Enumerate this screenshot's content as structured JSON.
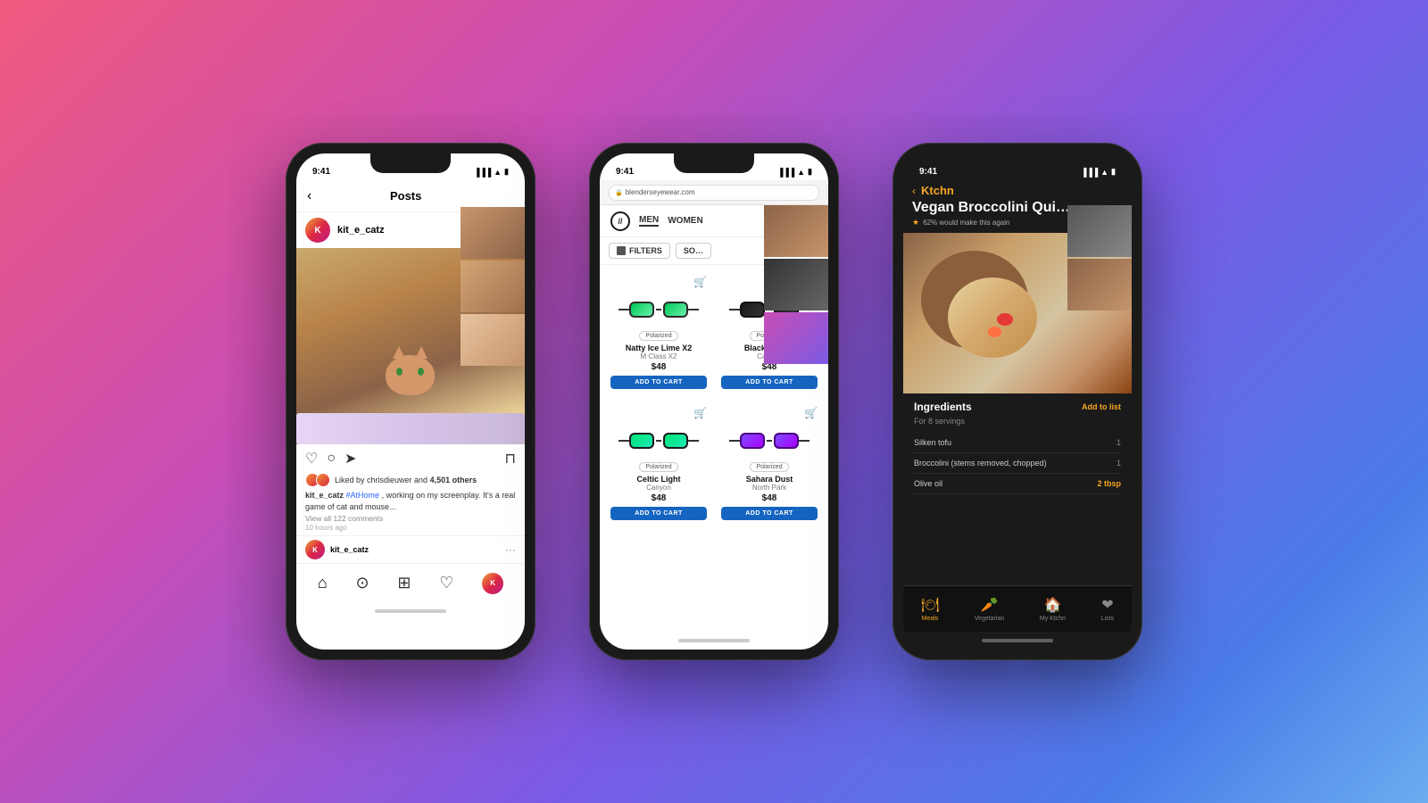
{
  "background": {
    "gradient": "linear-gradient(135deg, #f05a7e 0%, #c94db5 30%, #7b5be6 60%, #4a7be8 85%, #6aacf0 100%)"
  },
  "phone1": {
    "status_time": "9:41",
    "nav_title": "Posts",
    "username": "kit_e_catz",
    "liked_by": "Liked by chrisdieuwer and",
    "like_count": "4,501 others",
    "caption_user": "kit_e_catz",
    "caption_hashtag": "#AtHome",
    "caption_text": ", working on my screenplay. It's a real game of cat and mouse...",
    "view_comments": "View all 122 comments",
    "time_ago": "10 hours ago",
    "comment_username": "kit_e_catz"
  },
  "phone2": {
    "status_time": "9:41",
    "browser_url": "blenderseyewear.com",
    "nav_men": "MEN",
    "nav_women": "WOMEN",
    "filter_label": "FILTERS",
    "products": [
      {
        "name": "Natty Ice Lime X2",
        "sub": "M Class X2",
        "price": "$48",
        "badge": "Polarized",
        "color": "green",
        "cart_btn": "ADD TO CART"
      },
      {
        "name": "Black Tundra",
        "sub": "Canyon",
        "price": "$48",
        "badge": "Polarized",
        "color": "black",
        "cart_btn": "ADD TO CART"
      },
      {
        "name": "Celtic Light",
        "sub": "Canyon",
        "price": "$48",
        "badge": "Polarized",
        "color": "green2",
        "cart_btn": "ADD TO CART"
      },
      {
        "name": "Sahara Dust",
        "sub": "North Park",
        "price": "$48",
        "badge": "Polarized",
        "color": "purple",
        "cart_btn": "ADD TO CART"
      }
    ]
  },
  "phone3": {
    "status_time": "9:41",
    "brand": "Ktchn",
    "recipe_title": "Vegan Broccolini Qui…",
    "rating_text": "62% would make this again",
    "ingredients_title": "Ingredients",
    "servings": "For 8 servings",
    "add_to_list": "Add to list",
    "ingredients": [
      {
        "name": "Silken tofu",
        "qty": "1",
        "highlight": false
      },
      {
        "name": "Broccolini (stems removed, chopped)",
        "qty": "1",
        "highlight": false
      },
      {
        "name": "Olive oil",
        "qty": "2 tbsp",
        "highlight": true
      }
    ],
    "nav_items": [
      {
        "icon": "🍽",
        "label": "Meals",
        "active": true
      },
      {
        "icon": "🥕",
        "label": "Vegetarian",
        "active": false
      },
      {
        "icon": "🏠",
        "label": "My Ktchn",
        "active": false
      },
      {
        "icon": "❤",
        "label": "Lists",
        "active": false
      }
    ]
  }
}
